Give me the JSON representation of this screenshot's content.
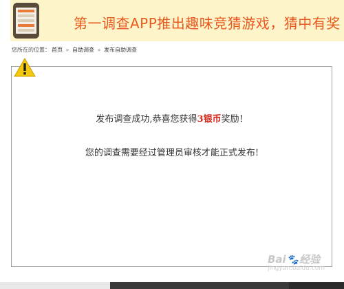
{
  "banner": {
    "text": "第一调查APP推出趣味竞猜游戏，猜中有奖",
    "image": "phone-app-icon"
  },
  "breadcrumb": {
    "prefix": "您所在的位置：",
    "items": [
      "首页",
      "自助调查",
      "发布自助调查"
    ],
    "separator": "»"
  },
  "notice": {
    "icon": "warning-icon",
    "line1_before": "发布调查成功,恭喜您获得",
    "line1_highlight": "3银币",
    "line1_after": "奖励！",
    "line2": "您的调查需要经过管理员审核才能正式发布!"
  },
  "watermark": {
    "text_left": "Bai",
    "text_right": "经验",
    "sub": "jingyan.baidu.com"
  },
  "colors": {
    "banner_bg": "#fdf5c9",
    "banner_text": "#e8581f",
    "highlight": "#d42a1e",
    "warning": "#f2c811"
  }
}
